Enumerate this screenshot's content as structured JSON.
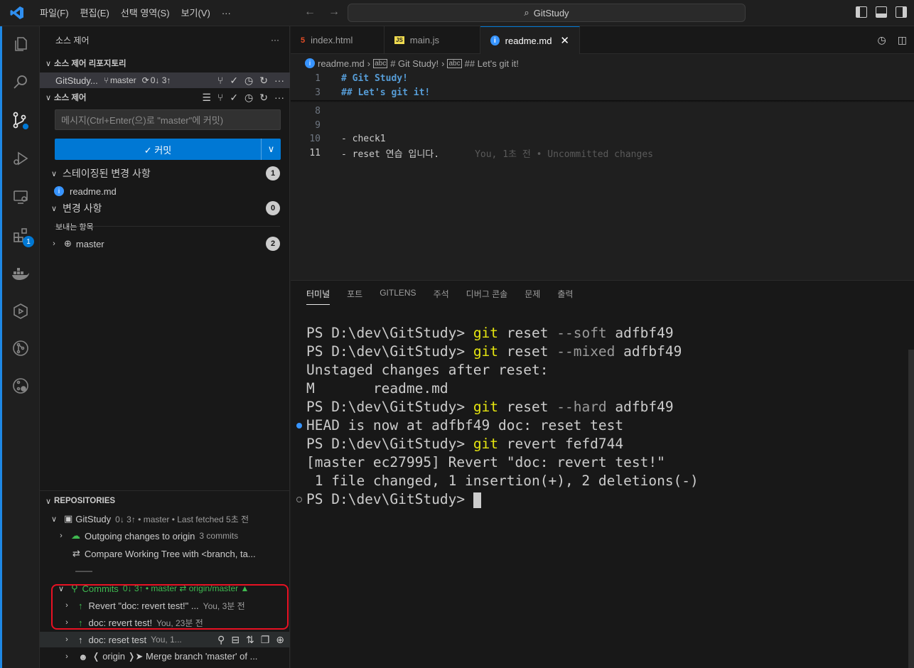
{
  "titlebar": {
    "menu": [
      "파일(F)",
      "편집(E)",
      "선택 영역(S)",
      "보기(V)",
      "···"
    ],
    "search_text": "GitStudy"
  },
  "activity": {
    "extensions_badge": "1"
  },
  "sidebar": {
    "title": "소스 제어",
    "repos_section": "소스 제어 리포지토리",
    "repo_name": "GitStudy...",
    "repo_branch": "master",
    "repo_sync": "0↓ 3↑",
    "scm_section": "소스 제어",
    "commit_placeholder": "메시지(Ctrl+Enter(으)로 \"master\"에 커밋)",
    "commit_button": "✓ 커밋",
    "staged_label": "스테이징된 변경 사항",
    "staged_count": "1",
    "staged_file": "readme.md",
    "changes_label": "변경 사항",
    "changes_count": "0",
    "outgoing_label": "보내는 항목",
    "outgoing_branch": "master",
    "outgoing_count": "2",
    "repositories_section": "REPOSITORIES",
    "gl_repo": "GitStudy",
    "gl_repo_meta": "0↓ 3↑ • master • Last fetched 5초 전",
    "gl_outgoing": "Outgoing changes to origin",
    "gl_outgoing_meta": "3 commits",
    "gl_compare": "Compare Working Tree with <branch, ta...",
    "gl_separator": "——",
    "gl_commits": "Commits",
    "gl_commits_meta": "0↓ 3↑ • master  ⇄  origin/master ▲",
    "commits": [
      {
        "msg": "Revert \"doc: revert test!\" ...",
        "meta": "You, 3분 전"
      },
      {
        "msg": "doc: revert test!",
        "meta": "You, 23분 전"
      },
      {
        "msg": "doc: reset test",
        "meta": "You, 1..."
      },
      {
        "msg": "❬ origin ❭➤  Merge branch 'master' of ...",
        "meta": ""
      }
    ]
  },
  "editor": {
    "tabs": [
      {
        "label": "index.html",
        "icon": "5"
      },
      {
        "label": "main.js",
        "icon": "JS"
      },
      {
        "label": "readme.md",
        "icon": "i"
      }
    ],
    "breadcrumb": [
      "readme.md",
      "# Git Study!",
      "## Let's git it!"
    ],
    "lines": [
      {
        "n": "1",
        "text": "# Git Study!"
      },
      {
        "n": "3",
        "text": "## Let's git it!"
      },
      {
        "n": "8",
        "text": ""
      },
      {
        "n": "9",
        "text": ""
      },
      {
        "n": "10",
        "text": "- check1"
      },
      {
        "n": "11",
        "text": "- reset 연습 입니다."
      }
    ],
    "blame": "You, 1초 전 • Uncommitted changes"
  },
  "panel": {
    "tabs": [
      "터미널",
      "포트",
      "GITLENS",
      "주석",
      "디버그 콘솔",
      "문제",
      "출력"
    ],
    "prompt": "PS D:\\dev\\GitStudy> ",
    "lines": {
      "l1_cmd": "git",
      "l1_rest1": " reset ",
      "l1_flag": "--soft",
      "l1_rest2": " adfbf49",
      "l2_cmd": "git",
      "l2_rest1": " reset ",
      "l2_flag": "--mixed",
      "l2_rest2": " adfbf49",
      "l3": "Unstaged changes after reset:",
      "l4": "M       readme.md",
      "l5_cmd": "git",
      "l5_rest1": " reset ",
      "l5_flag": "--hard",
      "l5_rest2": " adfbf49",
      "l6": "HEAD is now at adfbf49 doc: reset test",
      "l7_cmd": "git",
      "l7_rest": " revert fefd744",
      "l8": "[master ec27995] Revert \"doc: revert test!\"",
      "l9": " 1 file changed, 1 insertion(+), 2 deletions(-)"
    }
  },
  "colors": {
    "accent": "#0078d4",
    "highlight_box": "#e81123",
    "terminal_cmd": "#e5e510"
  }
}
